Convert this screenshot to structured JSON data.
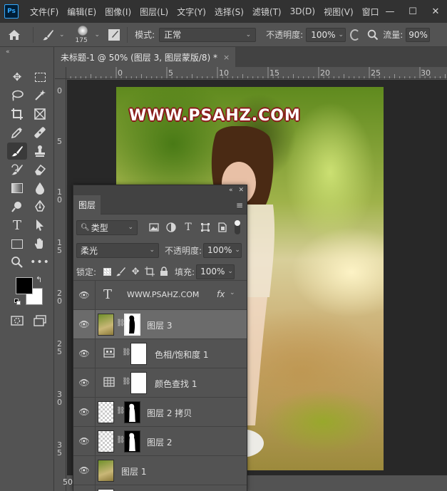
{
  "app": {
    "logo": "Ps"
  },
  "menu": [
    "文件(F)",
    "编辑(E)",
    "图像(I)",
    "图层(L)",
    "文字(Y)",
    "选择(S)",
    "滤镜(T)",
    "3D(D)",
    "视图(V)",
    "窗口(W"
  ],
  "window_controls": {
    "minimize": "—",
    "maximize": "☐",
    "close": "✕"
  },
  "options_bar": {
    "home_icon": "home-icon",
    "brush_size": "175",
    "mode_label": "模式:",
    "mode_value": "正常",
    "opacity_label": "不透明度:",
    "opacity_value": "100%",
    "flow_label": "流量:",
    "flow_value": "90%"
  },
  "document": {
    "tab_title": "未标题-1 @ 50% (图层 3, 图层蒙版/8) *",
    "tab_close": "×",
    "zoom": "50"
  },
  "rulers": {
    "top": [
      "0",
      "5",
      "10",
      "15",
      "20",
      "25",
      "30"
    ],
    "left": [
      "0",
      "5",
      "1\n0",
      "1\n5",
      "2\n0",
      "2\n5",
      "3\n0",
      "3\n5"
    ]
  },
  "canvas": {
    "watermark": "WWW.PSAHZ.COM"
  },
  "tools": [
    "move-icon",
    "marquee-icon",
    "lasso-icon",
    "magic-wand-icon",
    "crop-icon",
    "frame-icon",
    "eyedropper-icon",
    "healing-icon",
    "brush-icon",
    "stamp-icon",
    "history-brush-icon",
    "eraser-icon",
    "gradient-icon",
    "blur-icon",
    "dodge-icon",
    "pen-icon",
    "type-icon",
    "path-select-icon",
    "rectangle-icon",
    "hand-icon",
    "zoom-icon",
    "more-icon"
  ],
  "colors": {
    "foreground": "#000000",
    "background": "#ffffff",
    "accent": "#31a8ff"
  },
  "layers_panel": {
    "tab_label": "图层",
    "filter_kind": "类型",
    "blend_mode": "柔光",
    "opacity_label": "不透明度:",
    "opacity_value": "100%",
    "lock_label": "锁定:",
    "fill_label": "填充:",
    "fill_value": "100%",
    "layers": [
      {
        "name": "WWW.PSAHZ.COM",
        "type": "text",
        "fx": "fx"
      },
      {
        "name": "图层 3",
        "type": "pixel-mask",
        "selected": true
      },
      {
        "name": "色相/饱和度 1",
        "type": "adjustment"
      },
      {
        "name": "颜色查找 1",
        "type": "adjustment"
      },
      {
        "name": "图层 2 拷贝",
        "type": "pixel-mask"
      },
      {
        "name": "图层 2",
        "type": "pixel-mask"
      },
      {
        "name": "图层 1",
        "type": "pixel"
      }
    ]
  }
}
